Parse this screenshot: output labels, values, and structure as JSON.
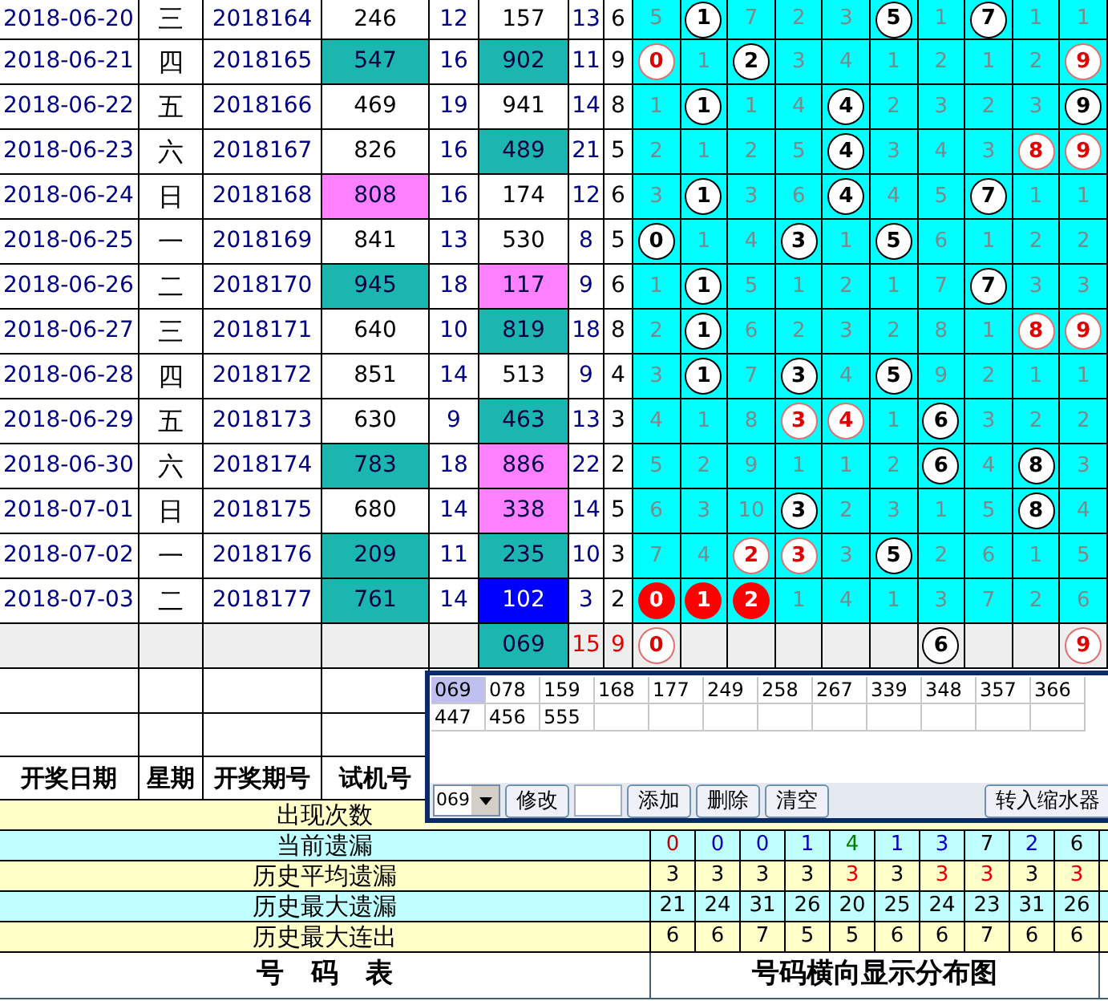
{
  "draws": [
    {
      "date": "2018-06-20",
      "weekday": "三",
      "period": "2018164",
      "trial": {
        "text": "246"
      },
      "trial_sum": "12",
      "draw": {
        "text": "157"
      },
      "col_a": "13",
      "col_b": "6",
      "cells": [
        {
          "text": "5",
          "kind": "miss"
        },
        {
          "text": "1",
          "kind": "hit"
        },
        {
          "text": "7",
          "kind": "miss"
        },
        {
          "text": "2",
          "kind": "miss"
        },
        {
          "text": "3",
          "kind": "miss"
        },
        {
          "text": "5",
          "kind": "hit"
        },
        {
          "text": "1",
          "kind": "miss"
        },
        {
          "text": "7",
          "kind": "hit"
        },
        {
          "text": "1",
          "kind": "miss"
        },
        {
          "text": "1",
          "kind": "miss"
        }
      ]
    },
    {
      "date": "2018-06-21",
      "weekday": "四",
      "period": "2018165",
      "trial": {
        "text": "547",
        "color": "#1cb6b0"
      },
      "trial_sum": "16",
      "draw": {
        "text": "902",
        "color": "#1cb6b0"
      },
      "col_a": "11",
      "col_b": "9",
      "cells": [
        {
          "text": "0",
          "kind": "repeat"
        },
        {
          "text": "1",
          "kind": "miss"
        },
        {
          "text": "2",
          "kind": "hit"
        },
        {
          "text": "3",
          "kind": "miss"
        },
        {
          "text": "4",
          "kind": "miss"
        },
        {
          "text": "1",
          "kind": "miss"
        },
        {
          "text": "2",
          "kind": "miss"
        },
        {
          "text": "1",
          "kind": "miss"
        },
        {
          "text": "2",
          "kind": "miss"
        },
        {
          "text": "9",
          "kind": "repeat"
        }
      ]
    },
    {
      "date": "2018-06-22",
      "weekday": "五",
      "period": "2018166",
      "trial": {
        "text": "469"
      },
      "trial_sum": "19",
      "draw": {
        "text": "941"
      },
      "col_a": "14",
      "col_b": "8",
      "cells": [
        {
          "text": "1",
          "kind": "miss"
        },
        {
          "text": "1",
          "kind": "hit"
        },
        {
          "text": "1",
          "kind": "miss"
        },
        {
          "text": "4",
          "kind": "miss"
        },
        {
          "text": "4",
          "kind": "hit"
        },
        {
          "text": "2",
          "kind": "miss"
        },
        {
          "text": "3",
          "kind": "miss"
        },
        {
          "text": "2",
          "kind": "miss"
        },
        {
          "text": "3",
          "kind": "miss"
        },
        {
          "text": "9",
          "kind": "hit"
        }
      ]
    },
    {
      "date": "2018-06-23",
      "weekday": "六",
      "period": "2018167",
      "trial": {
        "text": "826"
      },
      "trial_sum": "16",
      "draw": {
        "text": "489",
        "color": "#1cb6b0"
      },
      "col_a": "21",
      "col_b": "5",
      "cells": [
        {
          "text": "2",
          "kind": "miss"
        },
        {
          "text": "1",
          "kind": "miss"
        },
        {
          "text": "2",
          "kind": "miss"
        },
        {
          "text": "5",
          "kind": "miss"
        },
        {
          "text": "4",
          "kind": "hit"
        },
        {
          "text": "3",
          "kind": "miss"
        },
        {
          "text": "4",
          "kind": "miss"
        },
        {
          "text": "3",
          "kind": "miss"
        },
        {
          "text": "8",
          "kind": "repeat"
        },
        {
          "text": "9",
          "kind": "repeat"
        }
      ]
    },
    {
      "date": "2018-06-24",
      "weekday": "日",
      "period": "2018168",
      "trial": {
        "text": "808",
        "color": "#ff80ff"
      },
      "trial_sum": "16",
      "draw": {
        "text": "174"
      },
      "col_a": "12",
      "col_b": "6",
      "cells": [
        {
          "text": "3",
          "kind": "miss"
        },
        {
          "text": "1",
          "kind": "hit"
        },
        {
          "text": "3",
          "kind": "miss"
        },
        {
          "text": "6",
          "kind": "miss"
        },
        {
          "text": "4",
          "kind": "hit"
        },
        {
          "text": "4",
          "kind": "miss"
        },
        {
          "text": "5",
          "kind": "miss"
        },
        {
          "text": "7",
          "kind": "hit"
        },
        {
          "text": "1",
          "kind": "miss"
        },
        {
          "text": "1",
          "kind": "miss"
        }
      ]
    },
    {
      "date": "2018-06-25",
      "weekday": "一",
      "period": "2018169",
      "trial": {
        "text": "841"
      },
      "trial_sum": "13",
      "draw": {
        "text": "530"
      },
      "col_a": "8",
      "col_b": "5",
      "cells": [
        {
          "text": "0",
          "kind": "hit"
        },
        {
          "text": "1",
          "kind": "miss"
        },
        {
          "text": "4",
          "kind": "miss"
        },
        {
          "text": "3",
          "kind": "hit"
        },
        {
          "text": "1",
          "kind": "miss"
        },
        {
          "text": "5",
          "kind": "hit"
        },
        {
          "text": "6",
          "kind": "miss"
        },
        {
          "text": "1",
          "kind": "miss"
        },
        {
          "text": "2",
          "kind": "miss"
        },
        {
          "text": "2",
          "kind": "miss"
        }
      ]
    },
    {
      "date": "2018-06-26",
      "weekday": "二",
      "period": "2018170",
      "trial": {
        "text": "945",
        "color": "#1cb6b0"
      },
      "trial_sum": "18",
      "draw": {
        "text": "117",
        "color": "#ff80ff"
      },
      "col_a": "9",
      "col_b": "6",
      "cells": [
        {
          "text": "1",
          "kind": "miss"
        },
        {
          "text": "1",
          "kind": "hit"
        },
        {
          "text": "5",
          "kind": "miss"
        },
        {
          "text": "1",
          "kind": "miss"
        },
        {
          "text": "2",
          "kind": "miss"
        },
        {
          "text": "1",
          "kind": "miss"
        },
        {
          "text": "7",
          "kind": "miss"
        },
        {
          "text": "7",
          "kind": "hit"
        },
        {
          "text": "3",
          "kind": "miss"
        },
        {
          "text": "3",
          "kind": "miss"
        }
      ]
    },
    {
      "date": "2018-06-27",
      "weekday": "三",
      "period": "2018171",
      "trial": {
        "text": "640"
      },
      "trial_sum": "10",
      "draw": {
        "text": "819",
        "color": "#1cb6b0"
      },
      "col_a": "18",
      "col_b": "8",
      "cells": [
        {
          "text": "2",
          "kind": "miss"
        },
        {
          "text": "1",
          "kind": "hit"
        },
        {
          "text": "6",
          "kind": "miss"
        },
        {
          "text": "2",
          "kind": "miss"
        },
        {
          "text": "3",
          "kind": "miss"
        },
        {
          "text": "2",
          "kind": "miss"
        },
        {
          "text": "8",
          "kind": "miss"
        },
        {
          "text": "1",
          "kind": "miss"
        },
        {
          "text": "8",
          "kind": "repeat"
        },
        {
          "text": "9",
          "kind": "repeat"
        }
      ]
    },
    {
      "date": "2018-06-28",
      "weekday": "四",
      "period": "2018172",
      "trial": {
        "text": "851"
      },
      "trial_sum": "14",
      "draw": {
        "text": "513"
      },
      "col_a": "9",
      "col_b": "4",
      "cells": [
        {
          "text": "3",
          "kind": "miss"
        },
        {
          "text": "1",
          "kind": "hit"
        },
        {
          "text": "7",
          "kind": "miss"
        },
        {
          "text": "3",
          "kind": "hit"
        },
        {
          "text": "4",
          "kind": "miss"
        },
        {
          "text": "5",
          "kind": "hit"
        },
        {
          "text": "9",
          "kind": "miss"
        },
        {
          "text": "2",
          "kind": "miss"
        },
        {
          "text": "1",
          "kind": "miss"
        },
        {
          "text": "1",
          "kind": "miss"
        }
      ]
    },
    {
      "date": "2018-06-29",
      "weekday": "五",
      "period": "2018173",
      "trial": {
        "text": "630"
      },
      "trial_sum": "9",
      "draw": {
        "text": "463",
        "color": "#1cb6b0"
      },
      "col_a": "13",
      "col_b": "3",
      "cells": [
        {
          "text": "4",
          "kind": "miss"
        },
        {
          "text": "1",
          "kind": "miss"
        },
        {
          "text": "8",
          "kind": "miss"
        },
        {
          "text": "3",
          "kind": "repeat"
        },
        {
          "text": "4",
          "kind": "repeat"
        },
        {
          "text": "1",
          "kind": "miss"
        },
        {
          "text": "6",
          "kind": "hit"
        },
        {
          "text": "3",
          "kind": "miss"
        },
        {
          "text": "2",
          "kind": "miss"
        },
        {
          "text": "2",
          "kind": "miss"
        }
      ]
    },
    {
      "date": "2018-06-30",
      "weekday": "六",
      "period": "2018174",
      "trial": {
        "text": "783",
        "color": "#1cb6b0"
      },
      "trial_sum": "18",
      "draw": {
        "text": "886",
        "color": "#ff80ff"
      },
      "col_a": "22",
      "col_b": "2",
      "cells": [
        {
          "text": "5",
          "kind": "miss"
        },
        {
          "text": "2",
          "kind": "miss"
        },
        {
          "text": "9",
          "kind": "miss"
        },
        {
          "text": "1",
          "kind": "miss"
        },
        {
          "text": "1",
          "kind": "miss"
        },
        {
          "text": "2",
          "kind": "miss"
        },
        {
          "text": "6",
          "kind": "hit"
        },
        {
          "text": "4",
          "kind": "miss"
        },
        {
          "text": "8",
          "kind": "hit"
        },
        {
          "text": "3",
          "kind": "miss"
        }
      ]
    },
    {
      "date": "2018-07-01",
      "weekday": "日",
      "period": "2018175",
      "trial": {
        "text": "680"
      },
      "trial_sum": "14",
      "draw": {
        "text": "338",
        "color": "#ff80ff"
      },
      "col_a": "14",
      "col_b": "5",
      "cells": [
        {
          "text": "6",
          "kind": "miss"
        },
        {
          "text": "3",
          "kind": "miss"
        },
        {
          "text": "10",
          "kind": "miss"
        },
        {
          "text": "3",
          "kind": "hit"
        },
        {
          "text": "2",
          "kind": "miss"
        },
        {
          "text": "3",
          "kind": "miss"
        },
        {
          "text": "1",
          "kind": "miss"
        },
        {
          "text": "5",
          "kind": "miss"
        },
        {
          "text": "8",
          "kind": "hit"
        },
        {
          "text": "4",
          "kind": "miss"
        }
      ]
    },
    {
      "date": "2018-07-02",
      "weekday": "一",
      "period": "2018176",
      "trial": {
        "text": "209",
        "color": "#1cb6b0"
      },
      "trial_sum": "11",
      "draw": {
        "text": "235",
        "color": "#1cb6b0"
      },
      "col_a": "10",
      "col_b": "3",
      "cells": [
        {
          "text": "7",
          "kind": "miss"
        },
        {
          "text": "4",
          "kind": "miss"
        },
        {
          "text": "2",
          "kind": "repeat"
        },
        {
          "text": "3",
          "kind": "repeat"
        },
        {
          "text": "3",
          "kind": "miss"
        },
        {
          "text": "5",
          "kind": "hit"
        },
        {
          "text": "2",
          "kind": "miss"
        },
        {
          "text": "6",
          "kind": "miss"
        },
        {
          "text": "1",
          "kind": "miss"
        },
        {
          "text": "5",
          "kind": "miss"
        }
      ]
    },
    {
      "date": "2018-07-03",
      "weekday": "二",
      "period": "2018177",
      "trial": {
        "text": "761",
        "color": "#1cb6b0"
      },
      "trial_sum": "14",
      "draw": {
        "text": "102",
        "color": "#0000ff"
      },
      "col_a": "3",
      "col_b": "2",
      "cells": [
        {
          "text": "0",
          "kind": "filled"
        },
        {
          "text": "1",
          "kind": "filled"
        },
        {
          "text": "2",
          "kind": "filled"
        },
        {
          "text": "1",
          "kind": "miss"
        },
        {
          "text": "4",
          "kind": "miss"
        },
        {
          "text": "1",
          "kind": "miss"
        },
        {
          "text": "3",
          "kind": "miss"
        },
        {
          "text": "7",
          "kind": "miss"
        },
        {
          "text": "2",
          "kind": "miss"
        },
        {
          "text": "6",
          "kind": "miss"
        }
      ]
    }
  ],
  "pending": {
    "draw": {
      "text": "069",
      "color": "#1cb6b0"
    },
    "col_a": "15",
    "col_b": "9",
    "cells": [
      {
        "text": "0",
        "kind": "repeat"
      },
      {
        "kind": "empty"
      },
      {
        "kind": "empty"
      },
      {
        "kind": "empty"
      },
      {
        "kind": "empty"
      },
      {
        "kind": "empty"
      },
      {
        "text": "6",
        "kind": "hit"
      },
      {
        "kind": "empty"
      },
      {
        "kind": "empty"
      },
      {
        "text": "9",
        "kind": "repeat"
      }
    ]
  },
  "header": [
    "开奖日期",
    "星期",
    "开奖期号",
    "试机号"
  ],
  "stats": [
    {
      "label": "出现次数",
      "color": "#ffffc8"
    },
    {
      "label": "当前遗漏",
      "color": "#c0ffff",
      "values": [
        {
          "text": "0",
          "color": "#c00000"
        },
        {
          "text": "0",
          "color": "#0000c0"
        },
        {
          "text": "0",
          "color": "#0000c0"
        },
        {
          "text": "1",
          "color": "#0000c0"
        },
        {
          "text": "4",
          "color": "#008000"
        },
        {
          "text": "1",
          "color": "#0000c0"
        },
        {
          "text": "3",
          "color": "#0000c0"
        },
        {
          "text": "7",
          "color": "#000000"
        },
        {
          "text": "2",
          "color": "#0000c0"
        },
        {
          "text": "6",
          "color": "#000000"
        }
      ]
    },
    {
      "label": "历史平均遗漏",
      "color": "#ffffc8",
      "values": [
        {
          "text": "3",
          "color": "#000000"
        },
        {
          "text": "3",
          "color": "#000000"
        },
        {
          "text": "3",
          "color": "#000000"
        },
        {
          "text": "3",
          "color": "#000000"
        },
        {
          "text": "3",
          "color": "#e00000"
        },
        {
          "text": "3",
          "color": "#000000"
        },
        {
          "text": "3",
          "color": "#e00000"
        },
        {
          "text": "3",
          "color": "#e00000"
        },
        {
          "text": "3",
          "color": "#000000"
        },
        {
          "text": "3",
          "color": "#e00000"
        }
      ]
    },
    {
      "label": "历史最大遗漏",
      "color": "#c0ffff",
      "values": [
        {
          "text": "21",
          "color": "#000000"
        },
        {
          "text": "24",
          "color": "#000000"
        },
        {
          "text": "31",
          "color": "#000000"
        },
        {
          "text": "26",
          "color": "#000000"
        },
        {
          "text": "20",
          "color": "#000000"
        },
        {
          "text": "25",
          "color": "#000000"
        },
        {
          "text": "24",
          "color": "#000000"
        },
        {
          "text": "23",
          "color": "#000000"
        },
        {
          "text": "31",
          "color": "#000000"
        },
        {
          "text": "26",
          "color": "#000000"
        }
      ]
    },
    {
      "label": "历史最大连出",
      "color": "#ffffc8",
      "values": [
        {
          "text": "6",
          "color": "#000000"
        },
        {
          "text": "6",
          "color": "#000000"
        },
        {
          "text": "7",
          "color": "#000000"
        },
        {
          "text": "5",
          "color": "#000000"
        },
        {
          "text": "5",
          "color": "#000000"
        },
        {
          "text": "6",
          "color": "#000000"
        },
        {
          "text": "6",
          "color": "#000000"
        },
        {
          "text": "7",
          "color": "#000000"
        },
        {
          "text": "6",
          "color": "#000000"
        },
        {
          "text": "6",
          "color": "#000000"
        }
      ]
    }
  ],
  "footer": {
    "left": "号　码　表",
    "right": "号码横向显示分布图"
  },
  "popup": {
    "items": [
      {
        "text": "069",
        "selected": true
      },
      {
        "text": "078",
        "selected": false
      },
      {
        "text": "159",
        "selected": false
      },
      {
        "text": "168",
        "selected": false
      },
      {
        "text": "177",
        "selected": false
      },
      {
        "text": "249",
        "selected": false
      },
      {
        "text": "258",
        "selected": false
      },
      {
        "text": "267",
        "selected": false
      },
      {
        "text": "339",
        "selected": false
      },
      {
        "text": "348",
        "selected": false
      },
      {
        "text": "357",
        "selected": false
      },
      {
        "text": "366",
        "selected": false
      },
      {
        "text": "447",
        "selected": false
      },
      {
        "text": "456",
        "selected": false
      },
      {
        "text": "555",
        "selected": false
      }
    ],
    "select_value": "069",
    "buttons": [
      "修改",
      "添加",
      "删除",
      "清空",
      "转入缩水器"
    ]
  }
}
